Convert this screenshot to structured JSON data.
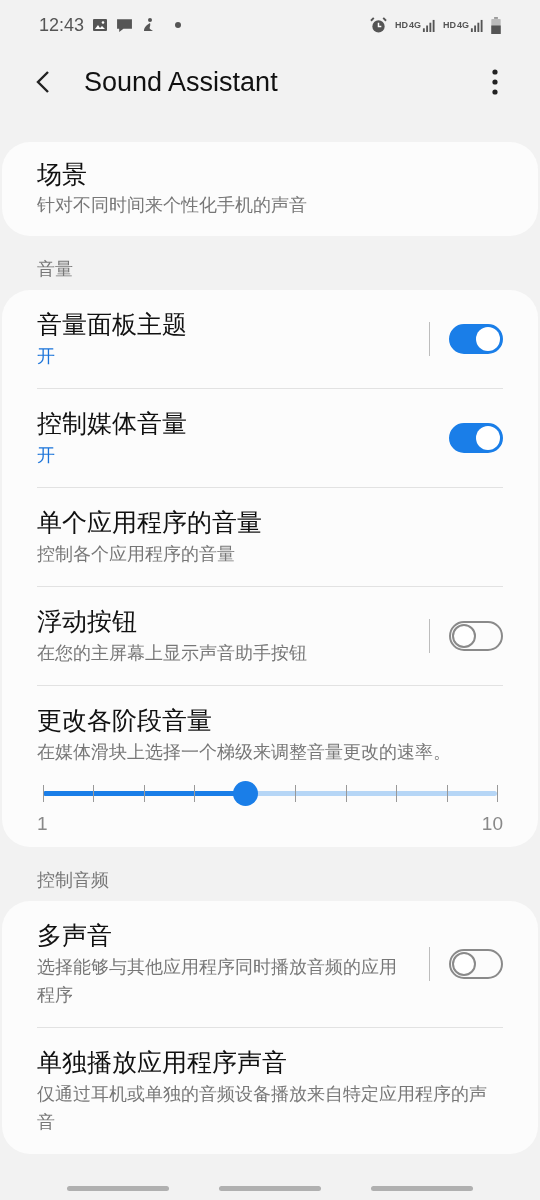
{
  "status_bar": {
    "time": "12:43",
    "network_labels": [
      "HD",
      "4G",
      "HD",
      "4G"
    ]
  },
  "header": {
    "title": "Sound Assistant"
  },
  "top_card": {
    "title": "场景",
    "subtitle": "针对不同时间来个性化手机的声音"
  },
  "sections": [
    {
      "title": "音量",
      "rows": [
        {
          "kind": "switch",
          "title": "音量面板主题",
          "subtitle": "开",
          "subtitle_active": true,
          "separator": true,
          "on": true
        },
        {
          "kind": "switch",
          "title": "控制媒体音量",
          "subtitle": "开",
          "subtitle_active": true,
          "separator": false,
          "on": true
        },
        {
          "kind": "plain",
          "title": "单个应用程序的音量",
          "subtitle": "控制各个应用程序的音量",
          "subtitle_active": false
        },
        {
          "kind": "switch",
          "title": "浮动按钮",
          "subtitle": "在您的主屏幕上显示声音助手按钮",
          "subtitle_active": false,
          "separator": true,
          "on": false
        },
        {
          "kind": "slider",
          "title": "更改各阶段音量",
          "subtitle": "在媒体滑块上选择一个梯级来调整音量更改的速率。",
          "subtitle_active": false,
          "level": 0.4444,
          "min_label": "1",
          "max_label": "10"
        }
      ]
    },
    {
      "title": "控制音频",
      "rows": [
        {
          "kind": "switch",
          "title": "多声音",
          "subtitle": "选择能够与其他应用程序同时播放音频的应用程序",
          "subtitle_active": false,
          "separator": true,
          "on": false
        },
        {
          "kind": "plain",
          "title": "单独播放应用程序声音",
          "subtitle": "仅通过耳机或单独的音频设备播放来自特定应用程序的声音",
          "subtitle_active": false
        }
      ]
    }
  ]
}
